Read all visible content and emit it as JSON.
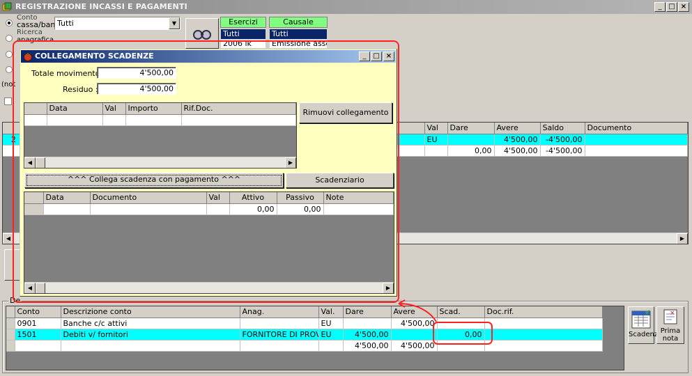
{
  "main_window": {
    "title": "REGISTRAZIONE INCASSI E PAGAMENTI",
    "controls": [
      "_",
      "□",
      "×"
    ]
  },
  "filters": {
    "conto_label_line1": "Conto",
    "conto_label_line2": "cassa/ban",
    "conto_value": "Tutti",
    "anagrafica_label_line1": "Ricerca",
    "anagrafica_label_line2": "anagrafica",
    "note_label": "(not",
    "esercizi_header": "Esercizi",
    "esercizi_items": [
      "Tutti",
      "2006 lk"
    ],
    "causale_header": "Causale",
    "causale_items": [
      "Tutti",
      "Emissione assegi"
    ]
  },
  "movimenti_grid": {
    "columns": [
      "Val",
      "Dare",
      "Avere",
      "Saldo",
      "Documento"
    ],
    "row_stub_first": "2",
    "rows": [
      {
        "val": "EU",
        "dare": "",
        "avere": "4'500,00",
        "saldo": "-4'500,00",
        "documento": ""
      },
      {
        "val": "",
        "dare": "0,00",
        "avere": "4'500,00",
        "saldo": "-4'500,00",
        "documento": ""
      }
    ]
  },
  "dettaglio": {
    "frame_label": "De",
    "columns": [
      "Conto",
      "Descrizione conto",
      "Anag.",
      "Val.",
      "Dare",
      "Avere",
      "Scad.",
      "Doc.rif."
    ],
    "rows": [
      {
        "conto": "0901",
        "descrizione": "Banche c/c attivi",
        "anag": "",
        "val": "EU",
        "dare": "",
        "avere": "4'500,00",
        "scad": "",
        "docrif": ""
      },
      {
        "conto": "1501",
        "descrizione": "Debiti v/ fornitori",
        "anag": "FORNITORE DI PROVA",
        "val": "EU",
        "dare": "4'500,00",
        "avere": "",
        "scad": "0,00",
        "docrif": ""
      },
      {
        "conto": "",
        "descrizione": "",
        "anag": "",
        "val": "",
        "dare": "4'500,00",
        "avere": "4'500,00",
        "scad": "",
        "docrif": ""
      }
    ],
    "btn_scadenziario_label": "Scadenz",
    "btn_primanota_line1": "Prima",
    "btn_primanota_line2": "nota"
  },
  "dialog": {
    "title": "COLLEGAMENTO SCADENZE",
    "controls": [
      "_",
      "□",
      "×"
    ],
    "totale_label": "Totale movimento :",
    "totale_value": "4'500,00",
    "residuo_label": "Residuo :",
    "residuo_value": "4'500,00",
    "collegati_columns": [
      "Data",
      "Val",
      "Importo",
      "Rif.Doc."
    ],
    "btn_rimuovi": "Rimuovi collegamento",
    "btn_collega": "^^^ Collega scadenza con pagamento ^^^",
    "btn_scadenziario": "Scadenziario",
    "scadenze_columns": [
      "Data",
      "Documento",
      "Val",
      "Attivo",
      "Passivo",
      "Note"
    ],
    "scadenze_rows": [
      {
        "data": "",
        "documento": "",
        "val": "",
        "attivo": "0,00",
        "passivo": "0,00",
        "note": ""
      }
    ]
  },
  "colors": {
    "highlight_row": "#00ffff",
    "dialog_background": "#ffffc0",
    "annotation_red": "#ff2020",
    "green_header": "#80ff80"
  }
}
